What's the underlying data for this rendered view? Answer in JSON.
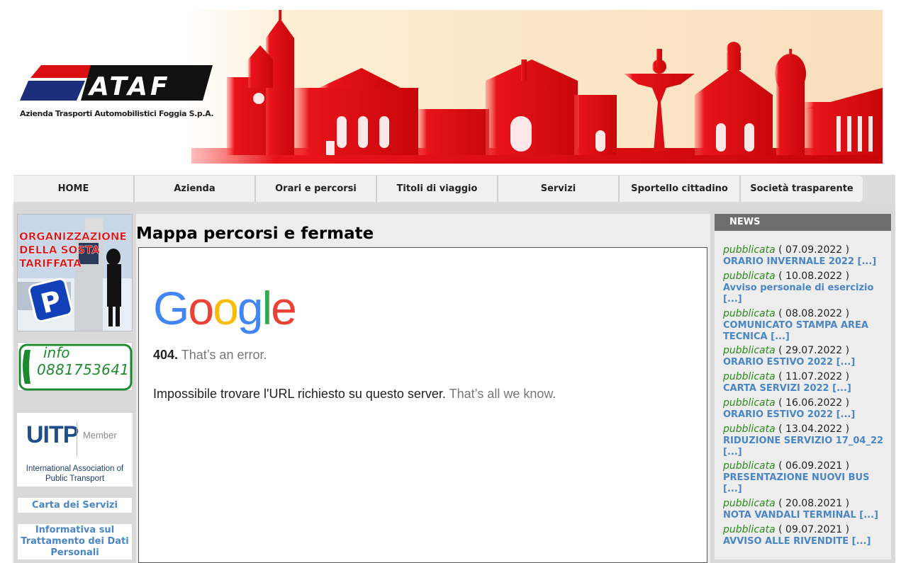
{
  "header": {
    "logo_text": "ATAF",
    "tagline": "Azienda Trasporti Automobilistici Foggia S.p.A."
  },
  "nav": {
    "items": [
      {
        "label": "HOME"
      },
      {
        "label": "Azienda"
      },
      {
        "label": "Orari e percorsi"
      },
      {
        "label": "Titoli di viaggio"
      },
      {
        "label": "Servizi"
      },
      {
        "label": "Sportello cittadino"
      },
      {
        "label": "Società trasparente"
      }
    ]
  },
  "sidebar": {
    "parking_banner": {
      "text": "ORGANIZZAZIONE DELLA SOSTA TARIFFATA",
      "parking_letter": "P"
    },
    "info_banner": {
      "label": "info",
      "phone": "0881753641"
    },
    "uitp_banner": {
      "logo_text": "UITP",
      "member_label": "Member",
      "caption": "International Association of Public Transport"
    },
    "links": [
      {
        "label": "Carta dei Servizi"
      },
      {
        "label": "Informativa sul Trattamento dei Dati Personali"
      }
    ]
  },
  "main": {
    "title": "Mappa percorsi e fermate",
    "error": {
      "google_logo": [
        "G",
        "o",
        "o",
        "g",
        "l",
        "e"
      ],
      "code": "404.",
      "code_message": "That’s an error.",
      "message": "Impossibile trovare l'URL richiesto su questo server.",
      "message_muted": "That’s all we know."
    }
  },
  "news": {
    "header": "NEWS",
    "published_label": "pubblicata",
    "items": [
      {
        "date": "( 07.09.2022 )",
        "title": "ORARIO INVERNALE 2022 [...]"
      },
      {
        "date": "( 10.08.2022 )",
        "title": "Avviso personale di esercizio [...]"
      },
      {
        "date": "( 08.08.2022 )",
        "title": "COMUNICATO STAMPA AREA TECNICA [...]"
      },
      {
        "date": "( 29.07.2022 )",
        "title": "ORARIO ESTIVO 2022 [...]"
      },
      {
        "date": "( 11.07.2022 )",
        "title": "CARTA SERVIZI 2022 [...]"
      },
      {
        "date": "( 16.06.2022 )",
        "title": "ORARIO ESTIVO 2022 [...]"
      },
      {
        "date": "( 13.04.2022 )",
        "title": "RIDUZIONE SERVIZIO 17_04_22 [...]"
      },
      {
        "date": "( 06.09.2021 )",
        "title": "PRESENTAZIONE NUOVI BUS [...]"
      },
      {
        "date": "( 20.08.2021 )",
        "title": "NOTA VANDALI TERMINAL [...]"
      },
      {
        "date": "( 09.07.2021 )",
        "title": "AVVISO ALLE RIVENDITE [...]"
      }
    ]
  },
  "colors": {
    "google_blue": "#4285F4",
    "google_red": "#EA4335",
    "google_yellow": "#FBBC05",
    "google_green": "#34A853",
    "link_blue": "#4a86c5",
    "published_green": "#2a8a1a",
    "banner_red": "#d90f12"
  }
}
